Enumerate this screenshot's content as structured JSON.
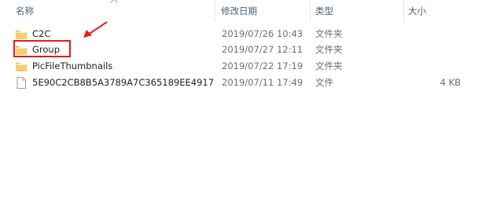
{
  "columns": {
    "name": "名称",
    "modified": "修改日期",
    "type": "类型",
    "size": "大小"
  },
  "files": [
    {
      "name": "C2C",
      "modified": "2019/07/26 10:43",
      "type": "文件夹",
      "size": "",
      "icon": "folder-icon"
    },
    {
      "name": "Group",
      "modified": "2019/07/27 12:11",
      "type": "文件夹",
      "size": "",
      "icon": "folder-icon"
    },
    {
      "name": "PicFileThumbnails",
      "modified": "2019/07/22 17:19",
      "type": "文件夹",
      "size": "",
      "icon": "folder-icon"
    },
    {
      "name": "5E90C2CB8B5A3789A7C365189EE4917",
      "modified": "2019/07/11 17:49",
      "type": "文件",
      "size": "4 KB",
      "icon": "file-icon"
    }
  ],
  "colors": {
    "header_text": "#4c607a",
    "highlight": "#e8191c",
    "folder": "#e8b94a"
  }
}
